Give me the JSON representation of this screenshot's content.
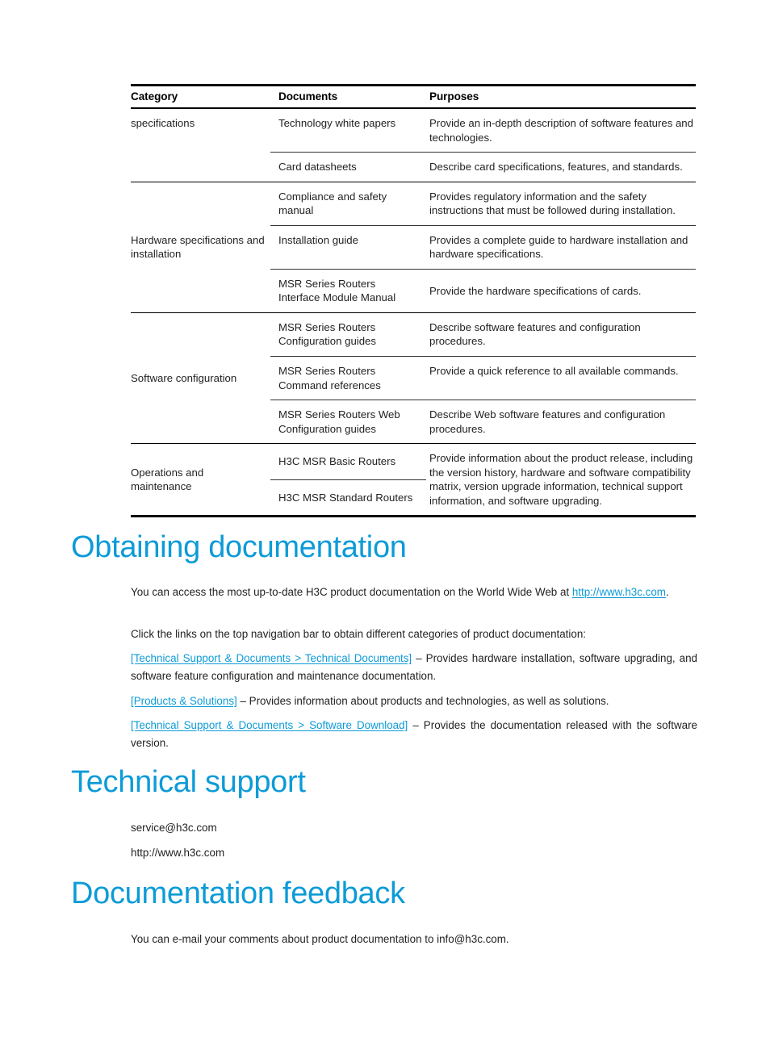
{
  "colors": {
    "heading": "#0d9bd7",
    "link": "#0d9bd7",
    "text": "#221f1f",
    "rule": "#000000"
  },
  "table": {
    "headers": {
      "category": "Category",
      "documents": "Documents",
      "purposes": "Purposes"
    },
    "groups": [
      {
        "category": "specifications",
        "rows": [
          {
            "document": "Technology white papers",
            "purpose": "Provide an in-depth description of software features and technologies."
          },
          {
            "document": "Card datasheets",
            "purpose": "Describe card specifications, features, and standards."
          }
        ]
      },
      {
        "category": "Hardware specifications and installation",
        "rows": [
          {
            "document": "Compliance and safety manual",
            "purpose": "Provides regulatory information and the safety instructions that must be followed during installation."
          },
          {
            "document": "Installation guide",
            "purpose": "Provides a complete guide to hardware installation and hardware specifications."
          },
          {
            "document": "MSR Series Routers Interface Module Manual",
            "purpose": "Provide the hardware specifications of cards."
          }
        ]
      },
      {
        "category": "Software configuration",
        "rows": [
          {
            "document": "MSR Series Routers Configuration guides",
            "purpose": "Describe software features and configuration procedures."
          },
          {
            "document": "MSR Series Routers Command references",
            "purpose": "Provide a quick reference to all available commands."
          },
          {
            "document": "MSR Series Routers Web Configuration guides",
            "purpose": "Describe Web software features and configuration procedures."
          }
        ]
      },
      {
        "category": "Operations and maintenance",
        "merged_purpose": "Provide information about the product release, including the version history, hardware and software compatibility matrix, version upgrade information, technical support information, and software upgrading.",
        "rows": [
          {
            "document": "H3C MSR Basic Routers"
          },
          {
            "document": "H3C MSR Standard Routers"
          }
        ]
      }
    ]
  },
  "sections": {
    "obtaining": {
      "heading": "Obtaining documentation",
      "intro_before": "You can access the most up-to-date H3C product documentation on the World Wide Web at ",
      "intro_link": "http://www.h3c.com",
      "intro_after": ".",
      "click_text": "Click the links on the top navigation bar to obtain different categories of product documentation:",
      "links": [
        {
          "link": "[Technical Support & Documents > Technical Documents]",
          "text": " – Provides hardware installation, software upgrading, and software feature configuration and maintenance documentation."
        },
        {
          "link": "[Products & Solutions]",
          "text": " – Provides information about products and technologies, as well as solutions."
        },
        {
          "link": "[Technical Support & Documents > Software Download]",
          "text": " – Provides the documentation released with the software version."
        }
      ]
    },
    "technical_support": {
      "heading": "Technical support",
      "email": "service@h3c.com",
      "website": "http://www.h3c.com"
    },
    "documentation_feedback": {
      "heading": "Documentation feedback",
      "text": "You can e-mail your comments about product documentation to info@h3c.com."
    }
  }
}
